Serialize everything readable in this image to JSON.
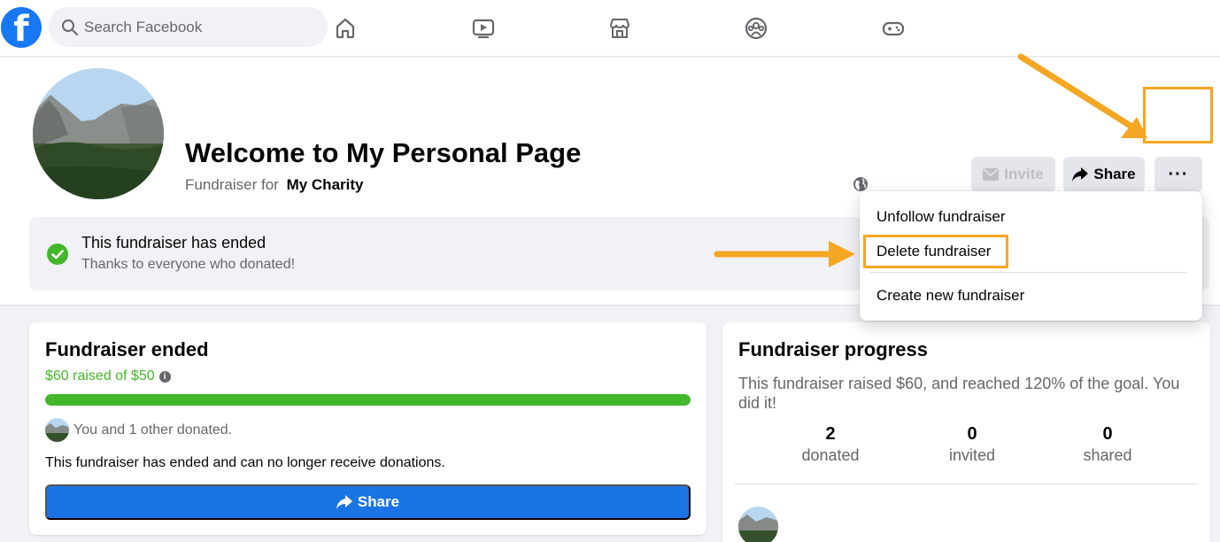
{
  "nav": {
    "logo_letter": "f",
    "search_placeholder": "Search Facebook",
    "icons": [
      "home-icon",
      "watch-icon",
      "marketplace-icon",
      "groups-icon",
      "gaming-icon"
    ]
  },
  "header": {
    "title": "Welcome to My Personal Page",
    "fundraiser_for_label": "Fundraiser for",
    "charity_name": "My Charity",
    "invite_label": "Invite",
    "share_label": "Share",
    "more_label": "···"
  },
  "ended_banner": {
    "title": "This fundraiser has ended",
    "subtitle": "Thanks to everyone who donated!"
  },
  "menu": {
    "items": [
      {
        "label": "Unfollow fundraiser"
      },
      {
        "label": "Delete fundraiser"
      },
      {
        "label": "Create new fundraiser"
      }
    ]
  },
  "left_card": {
    "title": "Fundraiser ended",
    "raised_text": "$60 raised of $50",
    "progress_fraction": 1.0,
    "donors_text": "You and 1 other donated.",
    "ended_note": "This fundraiser has ended and can no longer receive donations.",
    "share_label": "Share"
  },
  "right_card": {
    "title": "Fundraiser progress",
    "description": "This fundraiser raised $60, and reached 120% of the goal. You did it!",
    "stats": [
      {
        "value": "2",
        "label": "donated"
      },
      {
        "value": "0",
        "label": "invited"
      },
      {
        "value": "0",
        "label": "shared"
      }
    ]
  },
  "colors": {
    "brand_blue": "#1877f2",
    "success_green": "#42b72a",
    "highlight_orange": "#f5a623"
  }
}
